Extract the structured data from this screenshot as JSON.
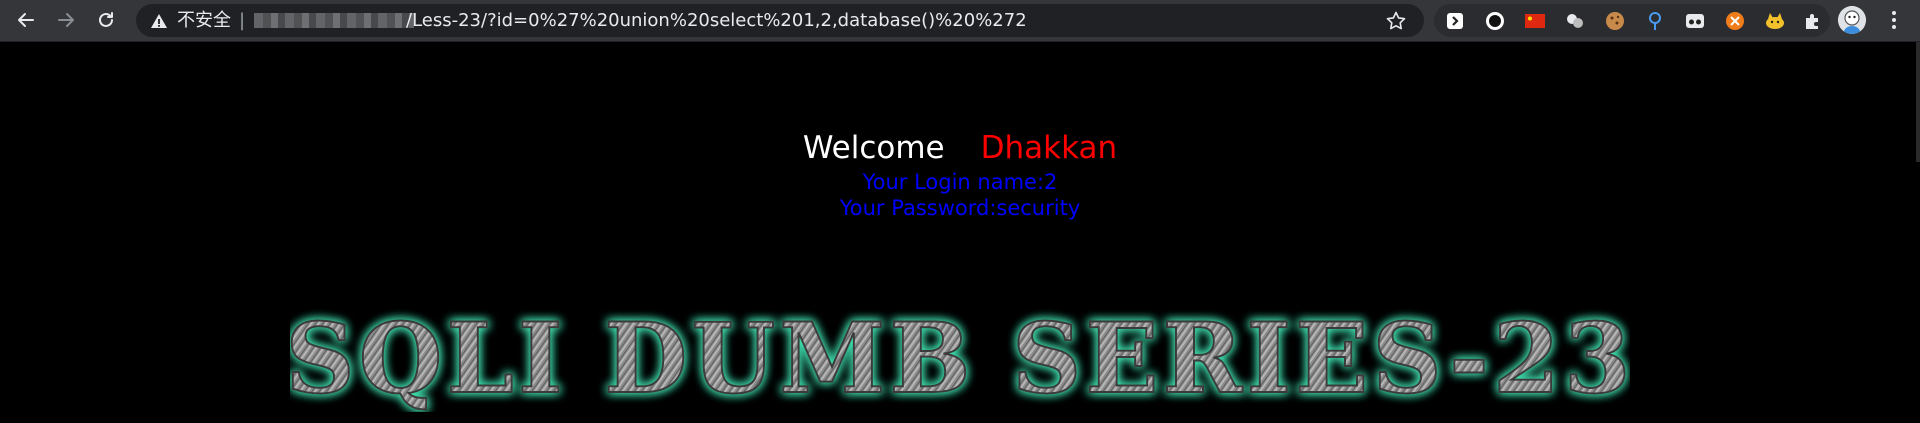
{
  "browser": {
    "security_label": "不安全",
    "separator": "|",
    "url_path": "/Less-23/?id=0%27%20union%20select%201,2,database()%20%272",
    "extensions": [
      "reader-icon",
      "circle-record-icon",
      "china-flag-icon",
      "cloud-icon",
      "cookie-icon",
      "pin-icon",
      "mask-icon",
      "orange-circle-icon",
      "cat-icon",
      "puzzle-icon"
    ]
  },
  "page": {
    "welcome": "Welcome",
    "username": "Dhakkan",
    "login_name": "Your Login name:2",
    "password": "Your Password:security",
    "banner": "SQLI DUMB SERIES-23"
  },
  "colors": {
    "background": "#000000",
    "welcome": "#ffffff",
    "username": "#ff0000",
    "info": "#0000ff",
    "banner_glow": "#3fe0b0"
  }
}
